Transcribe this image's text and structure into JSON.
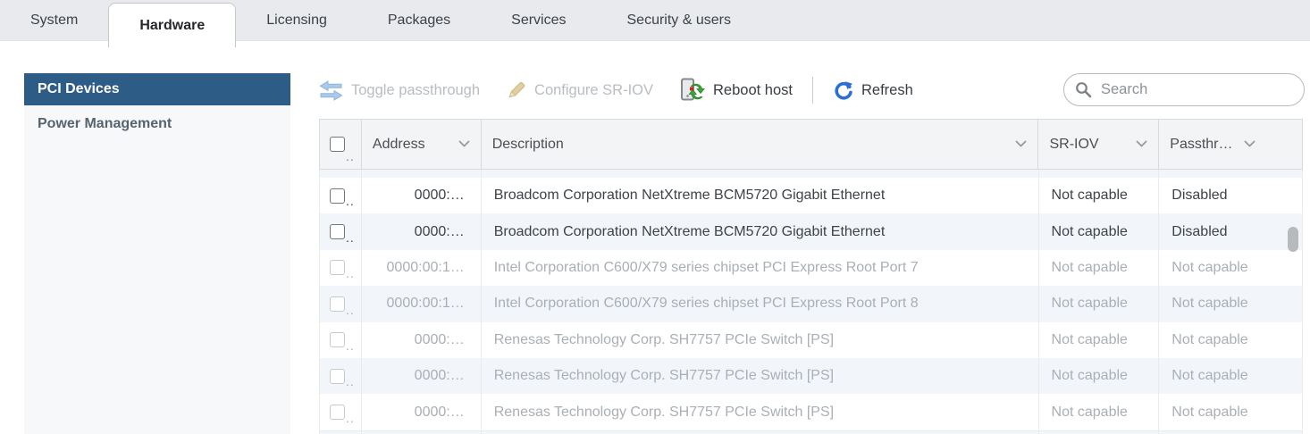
{
  "tabs": [
    {
      "label": "System",
      "active": false
    },
    {
      "label": "Hardware",
      "active": true
    },
    {
      "label": "Licensing",
      "active": false
    },
    {
      "label": "Packages",
      "active": false
    },
    {
      "label": "Services",
      "active": false
    },
    {
      "label": "Security & users",
      "active": false
    }
  ],
  "sidebar": {
    "items": [
      {
        "label": "PCI Devices",
        "selected": true
      },
      {
        "label": "Power Management",
        "selected": false
      }
    ]
  },
  "toolbar": {
    "toggle_passthrough_label": "Toggle passthrough",
    "configure_sriov_label": "Configure SR-IOV",
    "reboot_host_label": "Reboot host",
    "refresh_label": "Refresh"
  },
  "search": {
    "placeholder": "Search",
    "value": ""
  },
  "table": {
    "ellipsis": "..",
    "headers": {
      "address": "Address",
      "description": "Description",
      "sriov": "SR-IOV",
      "passthrough": "Passthr…"
    },
    "rows": [
      {
        "address": "0000:…",
        "description": "Broadcom Corporation NetXtreme BCM5720 Gigabit Ethernet",
        "sriov": "Not capable",
        "passthrough": "Disabled",
        "state": "enabled"
      },
      {
        "address": "0000:…",
        "description": "Broadcom Corporation NetXtreme BCM5720 Gigabit Ethernet",
        "sriov": "Not capable",
        "passthrough": "Disabled",
        "state": "enabled"
      },
      {
        "address": "0000:00:1…",
        "description": "Intel Corporation C600/X79 series chipset PCI Express Root Port 7",
        "sriov": "Not capable",
        "passthrough": "Not capable",
        "state": "disabled"
      },
      {
        "address": "0000:00:1…",
        "description": "Intel Corporation C600/X79 series chipset PCI Express Root Port 8",
        "sriov": "Not capable",
        "passthrough": "Not capable",
        "state": "disabled"
      },
      {
        "address": "0000:…",
        "description": "Renesas Technology Corp. SH7757 PCIe Switch [PS]",
        "sriov": "Not capable",
        "passthrough": "Not capable",
        "state": "disabled"
      },
      {
        "address": "0000:…",
        "description": "Renesas Technology Corp. SH7757 PCIe Switch [PS]",
        "sriov": "Not capable",
        "passthrough": "Not capable",
        "state": "disabled"
      },
      {
        "address": "0000:…",
        "description": "Renesas Technology Corp. SH7757 PCIe Switch [PS]",
        "sriov": "Not capable",
        "passthrough": "Not capable",
        "state": "disabled"
      }
    ]
  },
  "colors": {
    "tabstrip_bg": "#e8eaed",
    "sidebar_selected_bg": "#2d5c86",
    "row_stripe": "#f2f6fa",
    "refresh_icon_blue": "#2b6fd4",
    "reboot_icon_green": "#3da639",
    "reboot_icon_red": "#cc2a1e",
    "passthrough_arrow_blue": "#a9cae9",
    "pencil_tan": "#e0cf9f",
    "disabled_text": "#aaafb5",
    "enabled_text": "#3e4348"
  }
}
